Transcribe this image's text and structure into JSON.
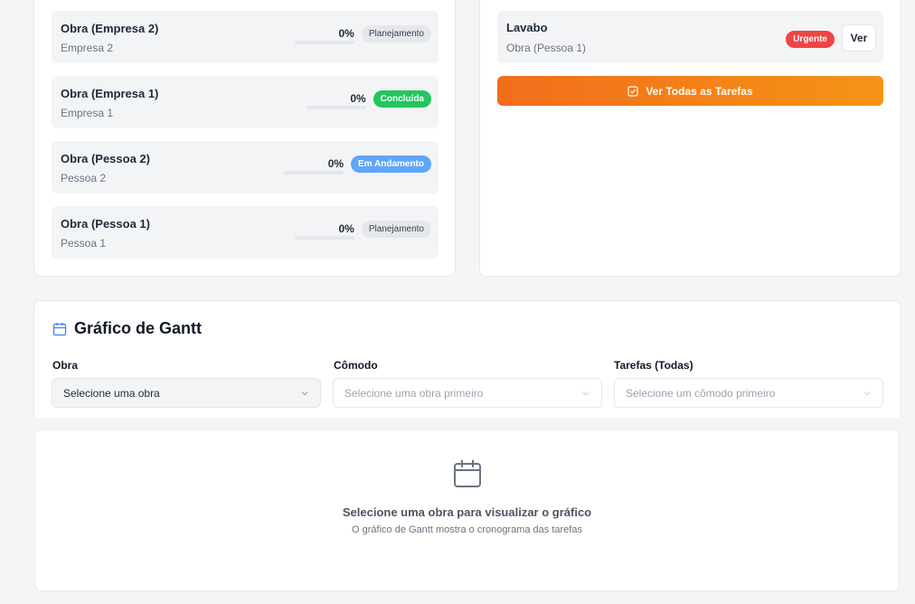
{
  "obras": [
    {
      "name": "Obra (Empresa 2)",
      "client": "Empresa 2",
      "percent": "0%",
      "status": "Planejamento",
      "status_type": "plan"
    },
    {
      "name": "Obra (Empresa 1)",
      "client": "Empresa 1",
      "percent": "0%",
      "status": "Concluída",
      "status_type": "done"
    },
    {
      "name": "Obra (Pessoa 2)",
      "client": "Pessoa 2",
      "percent": "0%",
      "status": "Em Andamento",
      "status_type": "prog"
    },
    {
      "name": "Obra (Pessoa 1)",
      "client": "Pessoa 1",
      "percent": "0%",
      "status": "Planejamento",
      "status_type": "plan"
    }
  ],
  "tarefas": {
    "item": {
      "name": "Lavabo",
      "obra": "Obra (Pessoa 1)",
      "badge": "Urgente",
      "action": "Ver"
    },
    "all_button": "Ver Todas as Tarefas"
  },
  "gantt": {
    "title": "Gráfico de Gantt",
    "fields": {
      "obra": {
        "label": "Obra",
        "placeholder": "Selecione uma obra"
      },
      "comodo": {
        "label": "Cômodo",
        "placeholder": "Selecione uma obra primeiro"
      },
      "tarefas": {
        "label": "Tarefas (Todas)",
        "placeholder": "Selecione um cômodo primeiro"
      }
    },
    "empty": {
      "title": "Selecione uma obra para visualizar o gráfico",
      "description": "O gráfico de Gantt mostra o cronograma das tarefas"
    }
  },
  "colors": {
    "accent": "#f97316",
    "status_done": "#22c55e",
    "status_progress": "#60a5fa",
    "status_urgent": "#ef4444"
  },
  "icons": {
    "gantt_title": "calendar-icon",
    "all_tasks_button": "checkbox-icon",
    "select_caret": "chevron-down-icon",
    "empty_state": "calendar-icon"
  }
}
